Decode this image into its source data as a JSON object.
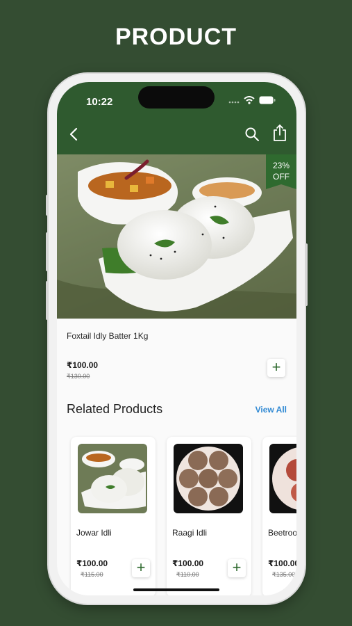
{
  "page": {
    "heading": "PRODUCT"
  },
  "status_bar": {
    "time": "10:22",
    "icons": [
      "cellular-icon",
      "wifi-icon",
      "battery-icon"
    ]
  },
  "navbar": {
    "icons": [
      "back-arrow-icon",
      "search-icon",
      "share-icon"
    ]
  },
  "product": {
    "discount_percent": "23%",
    "discount_label": "OFF",
    "name": "Foxtail Idly Batter 1Kg",
    "price": "₹100.00",
    "original_price": "₹130.00",
    "add_label": "+"
  },
  "related": {
    "title": "Related Products",
    "view_all": "View All",
    "items": [
      {
        "name": "Jowar Idli",
        "price": "₹100.00",
        "original_price": "₹115.00",
        "add_label": "+"
      },
      {
        "name": "Raagi Idli",
        "price": "₹100.00",
        "original_price": "₹110.00",
        "add_label": "+"
      },
      {
        "name": "Beetroo",
        "price": "₹100.00",
        "original_price": "₹135.00"
      }
    ]
  },
  "colors": {
    "background": "#344d32",
    "header": "#2f5a2f",
    "accent": "#2f6a2f",
    "link": "#2e88d3"
  }
}
